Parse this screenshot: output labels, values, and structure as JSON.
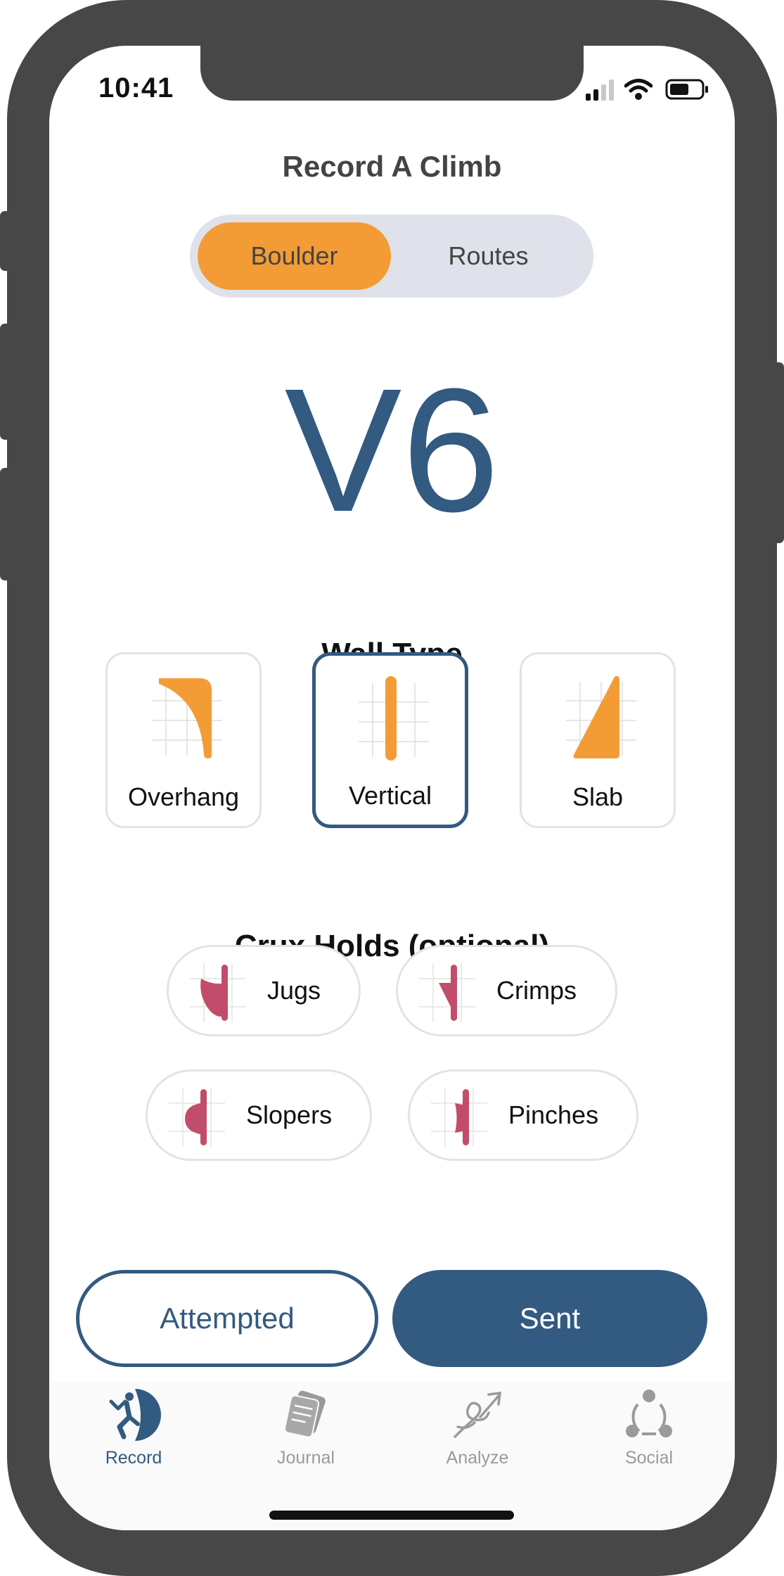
{
  "status": {
    "time": "10:41"
  },
  "page": {
    "title": "Record A Climb"
  },
  "segment": {
    "options": [
      "Boulder",
      "Routes"
    ],
    "selected": "Boulder"
  },
  "grade": "V6",
  "wall_type": {
    "heading": "Wall Type",
    "options": [
      {
        "label": "Overhang",
        "icon": "overhang-icon",
        "selected": false
      },
      {
        "label": "Vertical",
        "icon": "vertical-icon",
        "selected": true
      },
      {
        "label": "Slab",
        "icon": "slab-icon",
        "selected": false
      }
    ]
  },
  "crux_holds": {
    "heading": "Crux Holds (optional)",
    "options": [
      {
        "label": "Jugs",
        "icon": "jug-icon"
      },
      {
        "label": "Crimps",
        "icon": "crimp-icon"
      },
      {
        "label": "Slopers",
        "icon": "sloper-icon"
      },
      {
        "label": "Pinches",
        "icon": "pinch-icon"
      }
    ]
  },
  "actions": {
    "attempted": "Attempted",
    "sent": "Sent"
  },
  "tabbar": {
    "items": [
      {
        "label": "Record",
        "icon": "climber-icon",
        "active": true
      },
      {
        "label": "Journal",
        "icon": "journal-icon",
        "active": false
      },
      {
        "label": "Analyze",
        "icon": "knot-icon",
        "active": false
      },
      {
        "label": "Social",
        "icon": "social-network-icon",
        "active": false
      }
    ]
  },
  "colors": {
    "primary": "#335a80",
    "accent": "#f39c36",
    "hold": "#c24d6b",
    "segment_bg": "#dfe2ea",
    "frame": "#474747"
  }
}
